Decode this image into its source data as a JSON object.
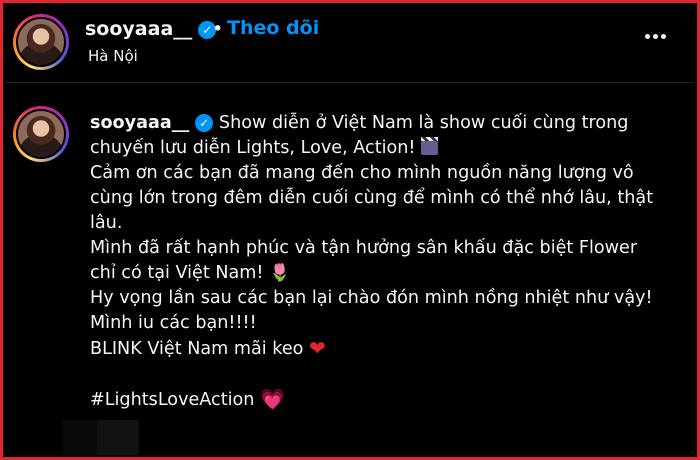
{
  "header": {
    "username": "sooyaaa__",
    "separator": "•",
    "follow_label": "Theo dõi",
    "location": "Hà Nội",
    "more_icon": "more-horizontal-icon"
  },
  "caption": {
    "username": "sooyaaa__",
    "lines": [
      "Show diễn ở Việt Nam là show cuối cùng trong",
      "chuyến lưu diễn Lights, Love, Action!",
      "Cảm ơn các bạn đã mang đến cho mình nguồn năng lượng vô",
      "cùng lớn trong đêm diễn cuối cùng để mình có thể nhớ lâu, thật",
      "lâu.",
      "Mình đã rất hạnh phúc và tận hưởng sân khấu đặc biệt Flower",
      "chỉ có tại Việt Nam!",
      "Hy vọng lần sau các bạn lại chào đón mình nồng nhiệt như vậy!",
      "Mình iu các bạn!!!!",
      "BLINK Việt Nam mãi keo",
      "#LightsLoveAction"
    ],
    "emoji": {
      "clapper": "clapper-board-icon",
      "rose": "🌷",
      "red_heart": "❤",
      "pink_heart": "💗"
    }
  },
  "colors": {
    "background": "#000000",
    "text": "#f5f5f5",
    "link": "#0095f6",
    "frame_border": "#e0262e"
  }
}
